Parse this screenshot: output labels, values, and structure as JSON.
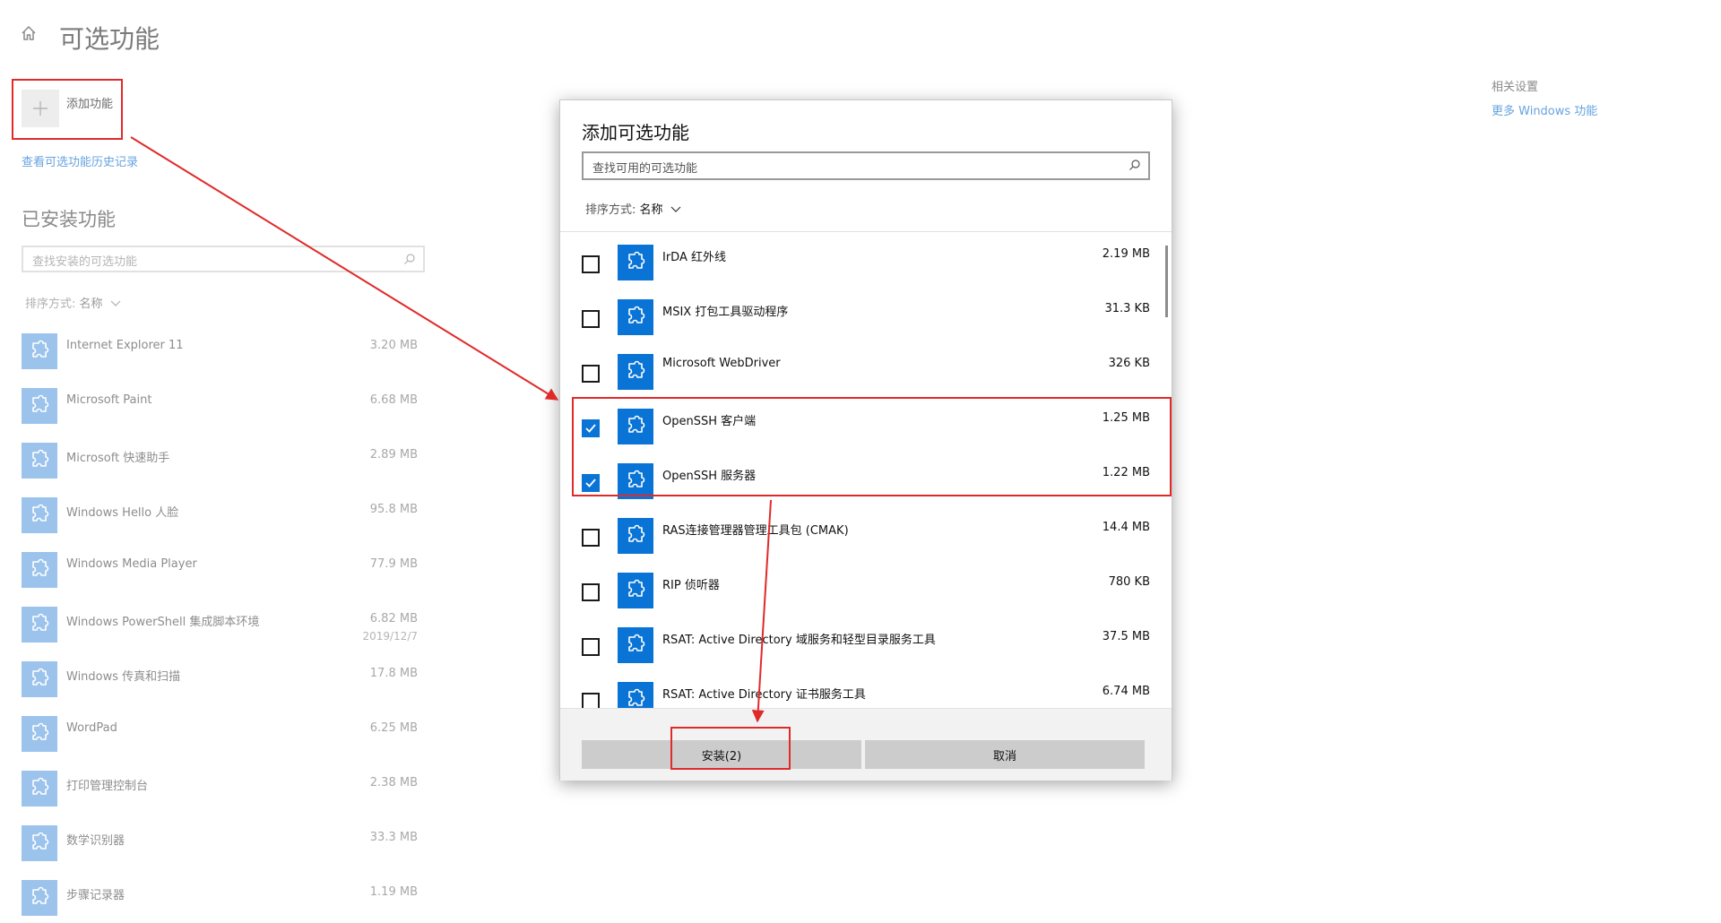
{
  "page": {
    "title": "可选功能",
    "add_feature_label": "添加功能",
    "history_link": "查看可选功能历史记录",
    "installed_heading": "已安装功能",
    "installed_search_placeholder": "查找安装的可选功能",
    "sort_prefix": "排序方式:",
    "sort_value": "名称",
    "icons": [
      "home-icon",
      "plus-icon",
      "search-icon",
      "chevron-down-icon",
      "puzzle-icon"
    ]
  },
  "related": {
    "heading": "相关设置",
    "link": "更多 Windows 功能"
  },
  "installed": [
    {
      "name": "Internet Explorer 11",
      "size": "3.20 MB"
    },
    {
      "name": "Microsoft Paint",
      "size": "6.68 MB"
    },
    {
      "name": "Microsoft 快速助手",
      "size": "2.89 MB"
    },
    {
      "name": "Windows Hello 人脸",
      "size": "95.8 MB"
    },
    {
      "name": "Windows Media Player",
      "size": "77.9 MB"
    },
    {
      "name": "Windows PowerShell 集成脚本环境",
      "size": "6.82 MB",
      "date": "2019/12/7"
    },
    {
      "name": "Windows 传真和扫描",
      "size": "17.8 MB"
    },
    {
      "name": "WordPad",
      "size": "6.25 MB"
    },
    {
      "name": "打印管理控制台",
      "size": "2.38 MB"
    },
    {
      "name": "数学识别器",
      "size": "33.3 MB"
    },
    {
      "name": "步骤记录器",
      "size": "1.19 MB"
    }
  ],
  "dialog": {
    "title": "添加可选功能",
    "search_placeholder": "查找可用的可选功能",
    "sort_prefix": "排序方式:",
    "sort_value": "名称",
    "items": [
      {
        "name": "IrDA 红外线",
        "size": "2.19 MB",
        "checked": false
      },
      {
        "name": "MSIX 打包工具驱动程序",
        "size": "31.3 KB",
        "checked": false
      },
      {
        "name": "Microsoft WebDriver",
        "size": "326 KB",
        "checked": false
      },
      {
        "name": "OpenSSH 客户端",
        "size": "1.25 MB",
        "checked": true
      },
      {
        "name": "OpenSSH 服务器",
        "size": "1.22 MB",
        "checked": true
      },
      {
        "name": "RAS连接管理器管理工具包 (CMAK)",
        "size": "14.4 MB",
        "checked": false
      },
      {
        "name": "RIP 侦听器",
        "size": "780 KB",
        "checked": false
      },
      {
        "name": "RSAT: Active Directory 域服务和轻型目录服务工具",
        "size": "37.5 MB",
        "checked": false
      },
      {
        "name": "RSAT: Active Directory 证书服务工具",
        "size": "6.74 MB",
        "checked": false
      }
    ],
    "install_label": "安装(2)",
    "cancel_label": "取消"
  },
  "colors": {
    "accent": "#0a74d6",
    "annotation": "#e02a2a",
    "link": "#66a3e0"
  }
}
